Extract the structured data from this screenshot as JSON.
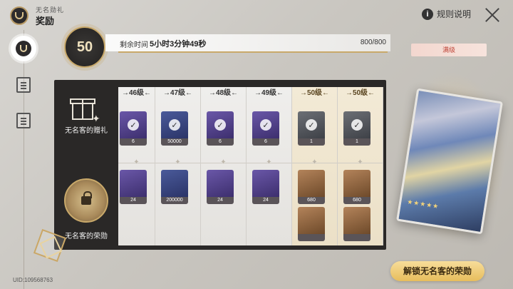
{
  "header": {
    "subtitle": "无名勋礼",
    "title": "奖励",
    "rules_label": "规则说明",
    "info_glyph": "i"
  },
  "level": {
    "current": "50"
  },
  "timebar": {
    "label": "剩余时间",
    "value": "5小时3分钟49秒",
    "xp": "800/800",
    "max_label": "满级"
  },
  "rows": {
    "gift_label": "无名客的赠礼",
    "honor_label": "无名客的荣勋"
  },
  "columns": [
    {
      "level": "46级",
      "gold": false,
      "top": {
        "qty": "6",
        "color": "purple"
      },
      "bottom": [
        {
          "qty": "24",
          "color": "purple"
        }
      ]
    },
    {
      "level": "47级",
      "gold": false,
      "top": {
        "qty": "50000",
        "color": "blue"
      },
      "bottom": [
        {
          "qty": "200000",
          "color": "blue"
        }
      ]
    },
    {
      "level": "48级",
      "gold": false,
      "top": {
        "qty": "6",
        "color": "purple"
      },
      "bottom": [
        {
          "qty": "24",
          "color": "purple"
        }
      ]
    },
    {
      "level": "49级",
      "gold": false,
      "top": {
        "qty": "6",
        "color": "purple"
      },
      "bottom": [
        {
          "qty": "24",
          "color": "purple"
        }
      ]
    },
    {
      "level": "50级",
      "gold": true,
      "top": {
        "qty": "1",
        "color": "grey"
      },
      "bottom": [
        {
          "qty": "680",
          "color": "orange"
        },
        {
          "qty": "",
          "color": "orange"
        }
      ]
    },
    {
      "level": "50级",
      "gold": true,
      "top": {
        "qty": "1",
        "color": "grey"
      },
      "bottom": [
        {
          "qty": "680",
          "color": "orange"
        },
        {
          "qty": "",
          "color": "orange"
        }
      ]
    }
  ],
  "card": {
    "stars": "★★★★★"
  },
  "unlock_button": "解锁无名客的荣勋",
  "uid": "UID:109568763",
  "colors": {
    "gold": "#c9a96a",
    "panel_dark": "#2a2827",
    "button_gold": "#e7bd5c",
    "max_red": "#c0473a"
  }
}
